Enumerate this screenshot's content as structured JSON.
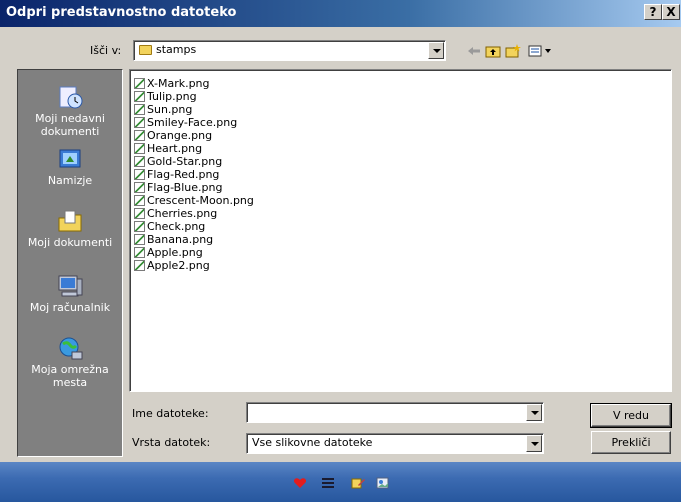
{
  "window": {
    "title": "Odpri predstavnostno datoteko",
    "help_glyph": "?",
    "close_glyph": "X"
  },
  "lookin": {
    "label": "Išči v:",
    "value": "stamps"
  },
  "toolbar": {
    "icons": [
      "back-arrow-icon",
      "up-folder-icon",
      "new-folder-icon",
      "view-menu-icon"
    ]
  },
  "places": [
    {
      "label": "Moji nedavni dokumenti",
      "icon": "recent-documents-icon"
    },
    {
      "label": "Namizje",
      "icon": "desktop-icon"
    },
    {
      "label": "Moji dokumenti",
      "icon": "my-documents-icon"
    },
    {
      "label": "Moj računalnik",
      "icon": "my-computer-icon"
    },
    {
      "label": "Moja omrežna mesta",
      "icon": "network-places-icon"
    }
  ],
  "files": [
    "X-Mark.png",
    "Tulip.png",
    "Sun.png",
    "Smiley-Face.png",
    "Orange.png",
    "Heart.png",
    "Gold-Star.png",
    "Flag-Red.png",
    "Flag-Blue.png",
    "Crescent-Moon.png",
    "Cherries.png",
    "Check.png",
    "Banana.png",
    "Apple.png",
    "Apple2.png"
  ],
  "filename": {
    "label": "Ime datoteke:",
    "value": ""
  },
  "filetype": {
    "label": "Vrsta datotek:",
    "value": "Vse slikovne datoteke"
  },
  "buttons": {
    "ok": "V redu",
    "cancel": "Prekliči"
  },
  "colors": {
    "title_start": "#0a246a",
    "title_end": "#a6caf0",
    "dialog_bg": "#d4d0c8",
    "places_bg": "#808080",
    "taskbar": "#3c6bb2"
  }
}
